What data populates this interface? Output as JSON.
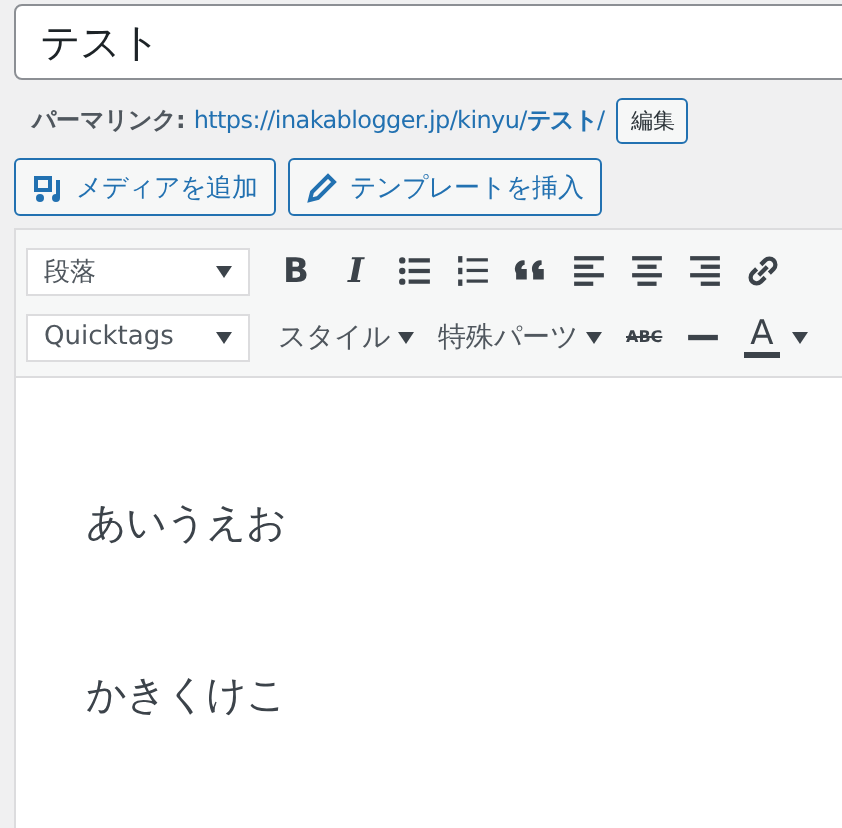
{
  "title_field": {
    "value": "テスト"
  },
  "permalink": {
    "label": "パーマリンク:",
    "url": "https://inakablogger.jp/kinyu/**テスト**/",
    "edit_button": "編集"
  },
  "media_buttons": [
    {
      "kind": "media",
      "label": "メディアを追加"
    },
    {
      "kind": "template",
      "label": "テンプレートを挿入"
    }
  ],
  "toolbar_rows": [
    [
      {
        "kind": "select",
        "label": "段落"
      },
      {
        "kind": "bold",
        "label": "B"
      },
      {
        "kind": "italic",
        "label": "I"
      },
      {
        "kind": "bullets"
      },
      {
        "kind": "numbers"
      },
      {
        "kind": "quote"
      },
      {
        "kind": "align-left"
      },
      {
        "kind": "align-center"
      },
      {
        "kind": "align-right"
      },
      {
        "kind": "link"
      }
    ],
    [
      {
        "kind": "select",
        "label": "Quicktags"
      },
      {
        "kind": "menu",
        "label": "スタイル"
      },
      {
        "kind": "menu",
        "label": "特殊パーツ"
      },
      {
        "kind": "strike",
        "label": "ABC"
      },
      {
        "kind": "rule"
      },
      {
        "kind": "color",
        "label": "A"
      }
    ]
  ],
  "content_paragraphs": [
    "あいうえお",
    "かきくけこ"
  ]
}
